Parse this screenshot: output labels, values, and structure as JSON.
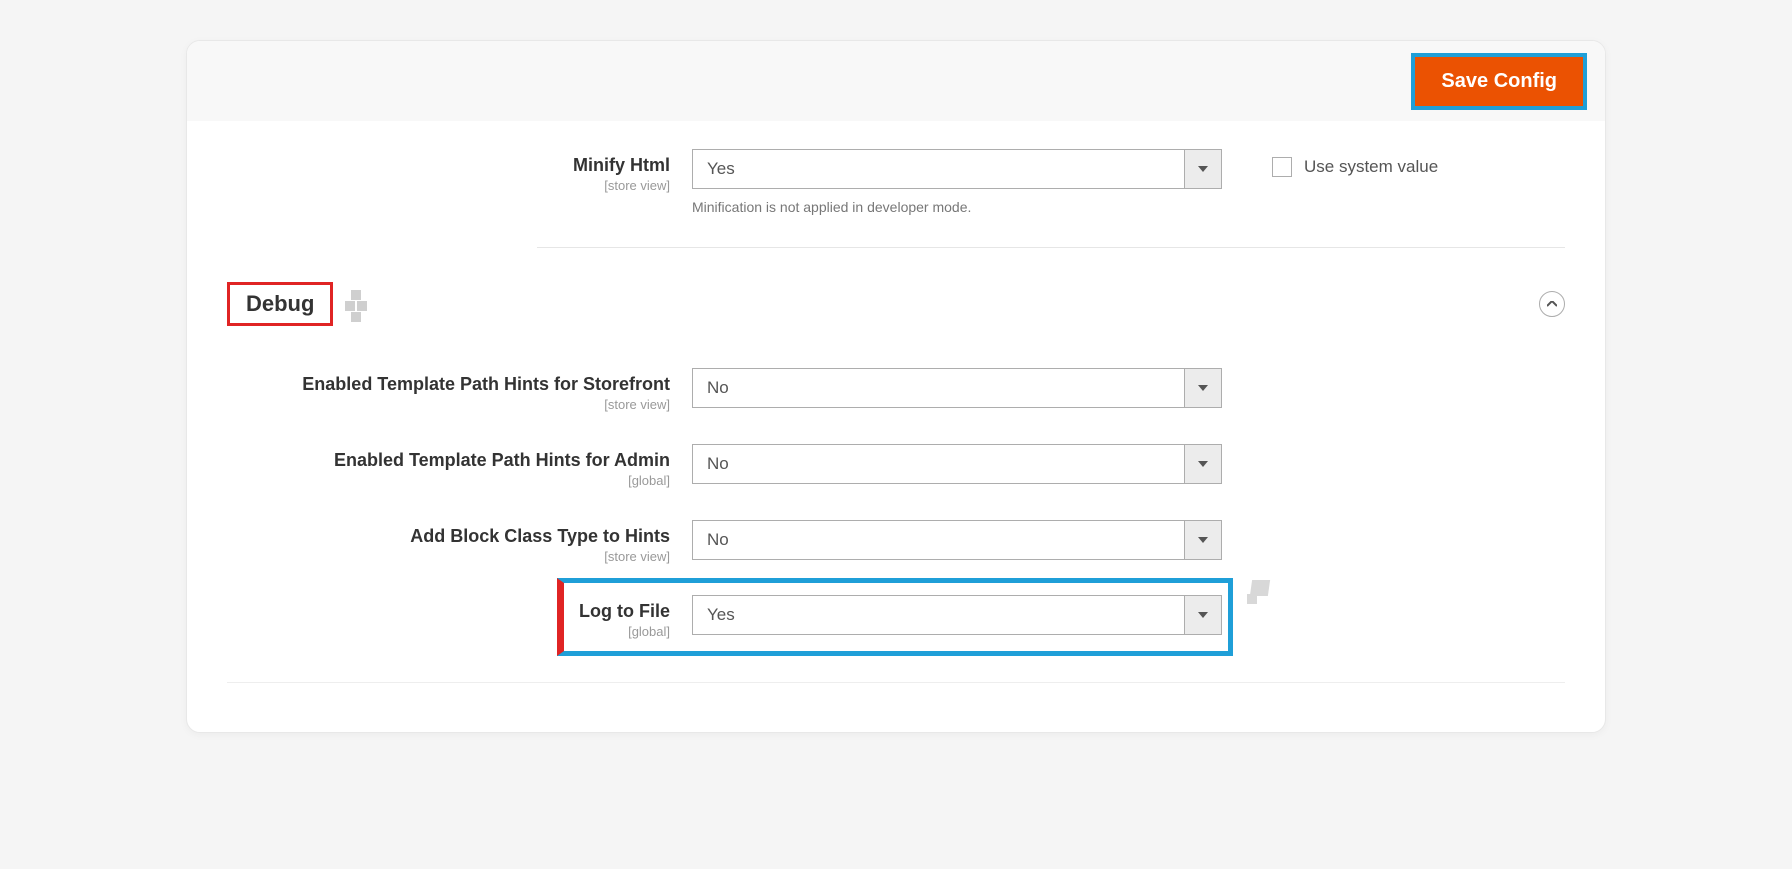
{
  "header": {
    "save_label": "Save Config"
  },
  "minify": {
    "label": "Minify Html",
    "scope": "[store view]",
    "value": "Yes",
    "note": "Minification is not applied in developer mode.",
    "use_system_label": "Use system value"
  },
  "debug_section": {
    "title": "Debug"
  },
  "fields": {
    "storefront_hints": {
      "label": "Enabled Template Path Hints for Storefront",
      "scope": "[store view]",
      "value": "No"
    },
    "admin_hints": {
      "label": "Enabled Template Path Hints for Admin",
      "scope": "[global]",
      "value": "No"
    },
    "block_class_hints": {
      "label": "Add Block Class Type to Hints",
      "scope": "[store view]",
      "value": "No"
    },
    "log_to_file": {
      "label": "Log to File",
      "scope": "[global]",
      "value": "Yes"
    }
  }
}
